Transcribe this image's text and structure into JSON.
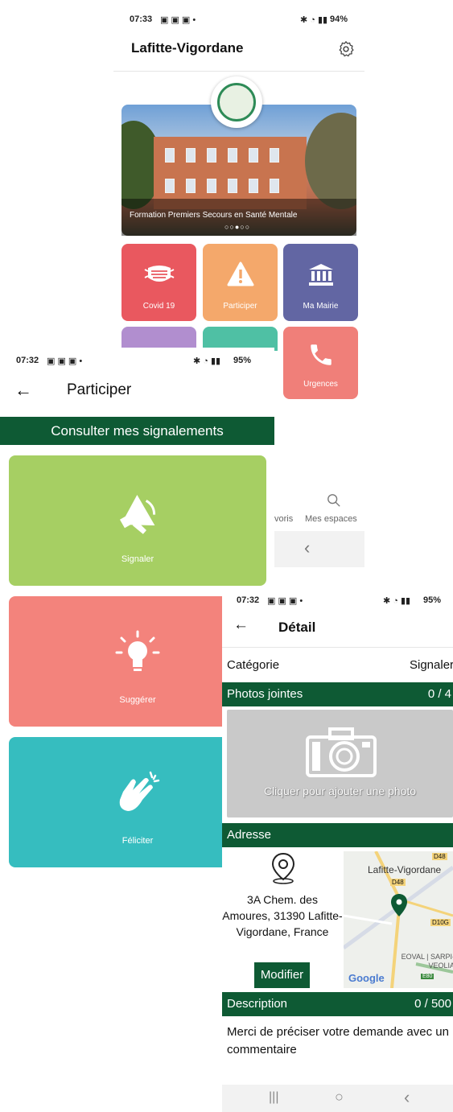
{
  "screen_home": {
    "status": {
      "time": "07:33",
      "battery": "94%"
    },
    "title": "Lafitte-Vigordane",
    "banner_caption": "Formation Premiers Secours en Santé Mentale",
    "banner_dots": "○○●○○",
    "tiles": [
      {
        "label": "Covid 19",
        "icon": "mask-icon",
        "color": "#e9585f"
      },
      {
        "label": "Participer",
        "icon": "warning-icon",
        "color": "#f4a86b"
      },
      {
        "label": "Ma Mairie",
        "icon": "townhall-icon",
        "color": "#6266a3"
      },
      {
        "label": "Urgences",
        "icon": "phone-icon",
        "color": "#f07f79"
      }
    ],
    "nav": {
      "fav_label": "voris",
      "spaces_label": "Mes espaces"
    },
    "back_glyph": "‹"
  },
  "screen_participer": {
    "status": {
      "time": "07:32",
      "battery": "95%"
    },
    "title": "Participer",
    "consult_button": "Consulter mes signalements",
    "cards": [
      {
        "label": "Signaler",
        "icon": "megaphone-icon",
        "color": "#a6cf63"
      },
      {
        "label": "Suggérer",
        "icon": "lightbulb-icon",
        "color": "#f3837c"
      },
      {
        "label": "Féliciter",
        "icon": "clapping-hands-icon",
        "color": "#36bdbf"
      }
    ]
  },
  "screen_detail": {
    "status": {
      "time": "07:32",
      "battery": "95%"
    },
    "title": "Détail",
    "category_label": "Catégorie",
    "category_value": "Signaler",
    "photos_label": "Photos jointes",
    "photos_count": "0 / 4",
    "photo_prompt": "Cliquer pour ajouter une photo",
    "address_label": "Adresse",
    "address_text": "3A Chem. des Amoures, 31390 Lafitte-Vigordane, France",
    "modify_button": "Modifier",
    "map": {
      "place": "Lafitte-Vigordane",
      "roads": [
        "D48",
        "D48",
        "D10G",
        "E80"
      ],
      "poi": "EOVAL | SARPI-VEOLIA",
      "provider": "Google"
    },
    "description_label": "Description",
    "description_count": "0 / 500",
    "description_placeholder": "Merci de préciser votre demande avec un commentaire",
    "nav": {
      "recent": "|||",
      "home": "○",
      "back": "‹"
    }
  },
  "colors": {
    "green": "#0e5a34",
    "gray_photo": "#c9c9c9"
  }
}
